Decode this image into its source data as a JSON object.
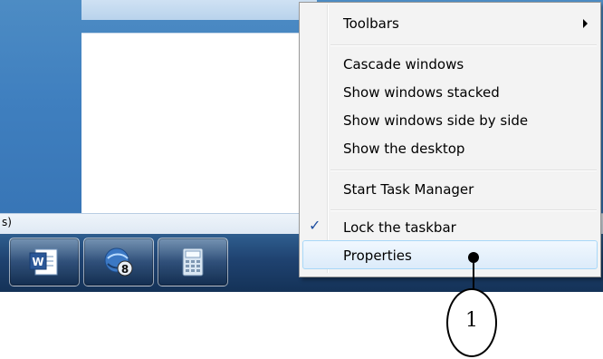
{
  "status": {
    "text": "s)"
  },
  "taskbar": {
    "buttons": [
      {
        "name": "word-app",
        "icon": "word-document-icon"
      },
      {
        "name": "accessibility-app",
        "icon": "globe-8-icon"
      },
      {
        "name": "calculator-app",
        "icon": "calculator-icon"
      }
    ]
  },
  "menu": {
    "items": [
      {
        "label": "Toolbars",
        "has_submenu": true
      },
      {
        "label": "Cascade windows"
      },
      {
        "label": "Show windows stacked"
      },
      {
        "label": "Show windows side by side"
      },
      {
        "label": "Show the desktop"
      },
      {
        "label": "Start Task Manager"
      },
      {
        "label": "Lock the taskbar",
        "checked": true
      },
      {
        "label": "Properties",
        "hovered": true
      }
    ]
  },
  "callout": {
    "number": "1"
  }
}
